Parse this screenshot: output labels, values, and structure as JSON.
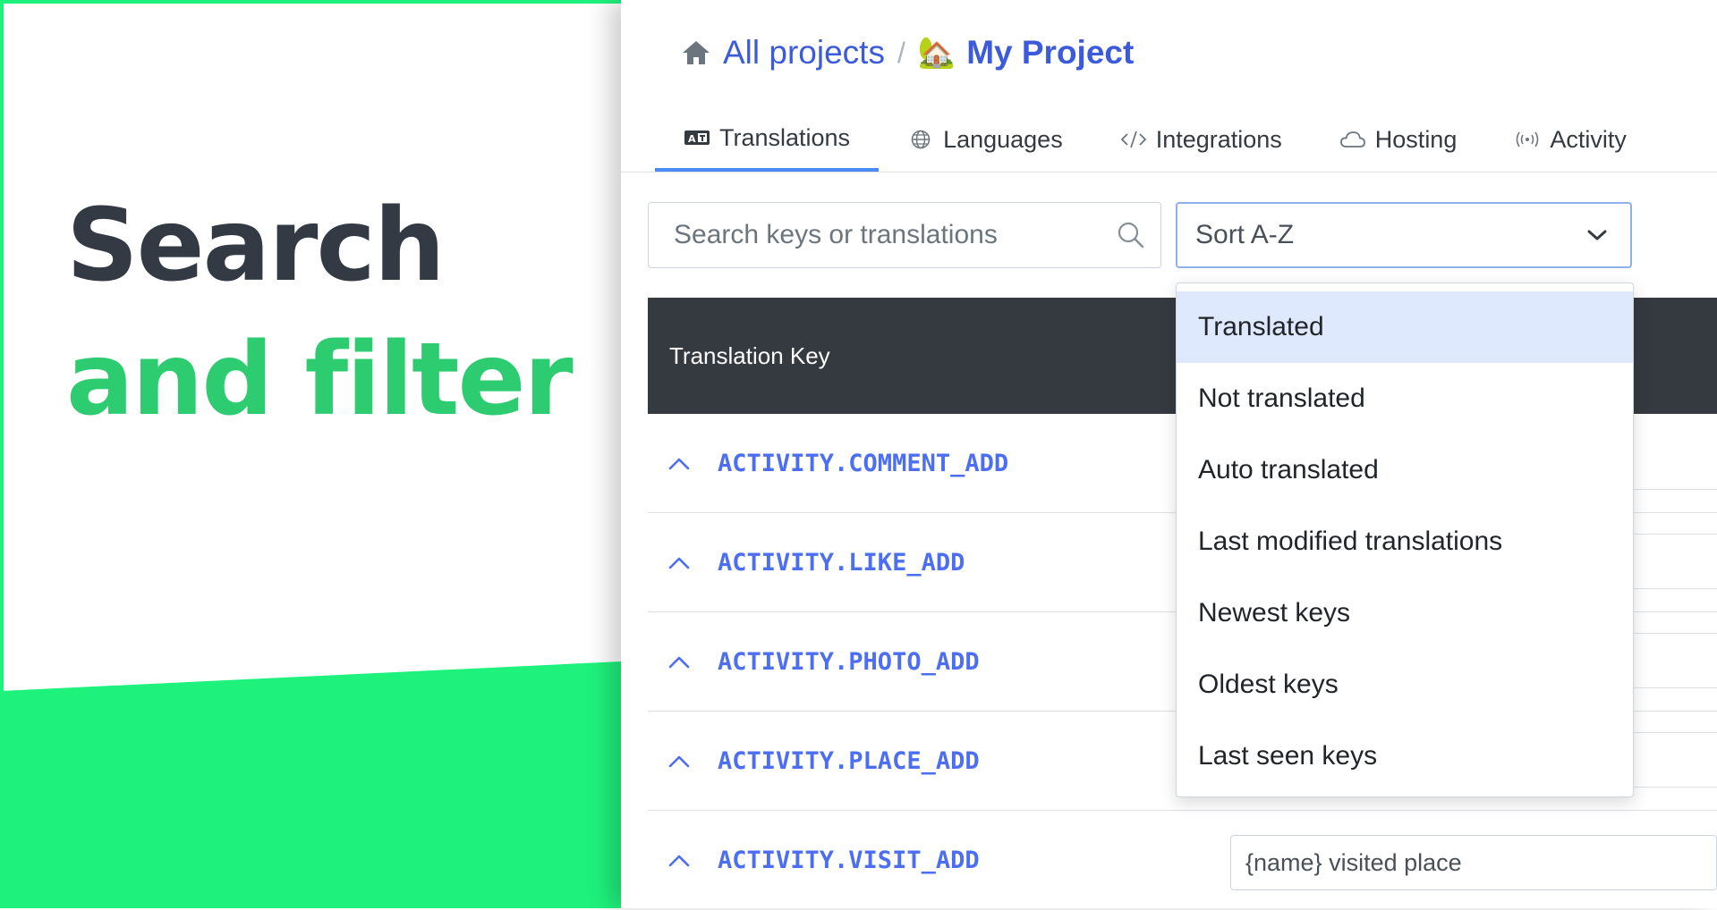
{
  "promo": {
    "title_line1": "Search",
    "title_line2": "and filter",
    "accent_color": "#1ef27c"
  },
  "breadcrumb": {
    "home_icon": "home-icon",
    "all_projects": "All projects",
    "separator": "/",
    "project_emoji": "🏡",
    "project_name": "My Project"
  },
  "tabs": [
    {
      "label": "Translations",
      "icon": "translate-icon",
      "active": true
    },
    {
      "label": "Languages",
      "icon": "globe-icon",
      "active": false
    },
    {
      "label": "Integrations",
      "icon": "code-icon",
      "active": false
    },
    {
      "label": "Hosting",
      "icon": "cloud-icon",
      "active": false
    },
    {
      "label": "Activity",
      "icon": "broadcast-icon",
      "active": false
    }
  ],
  "search": {
    "placeholder": "Search keys or translations",
    "value": ""
  },
  "sort": {
    "selected": "Sort A-Z"
  },
  "table": {
    "header": "Translation Key",
    "rows": [
      {
        "key": "ACTIVITY.COMMENT_ADD"
      },
      {
        "key": "ACTIVITY.LIKE_ADD"
      },
      {
        "key": "ACTIVITY.PHOTO_ADD"
      },
      {
        "key": "ACTIVITY.PLACE_ADD"
      },
      {
        "key": "ACTIVITY.VISIT_ADD",
        "translation": "{name} visited place"
      }
    ]
  },
  "dropdown": {
    "highlighted": "Translated",
    "options": [
      "Translated",
      "Not translated",
      "Auto translated",
      "Last modified translations",
      "Newest keys",
      "Oldest keys",
      "Last seen keys"
    ]
  },
  "colors": {
    "link": "#3b5bdb",
    "key": "#4c6ef5",
    "header_bg": "#343a40",
    "tab_underline": "#4c8bf5",
    "dropdown_highlight": "#dfe9fd"
  }
}
